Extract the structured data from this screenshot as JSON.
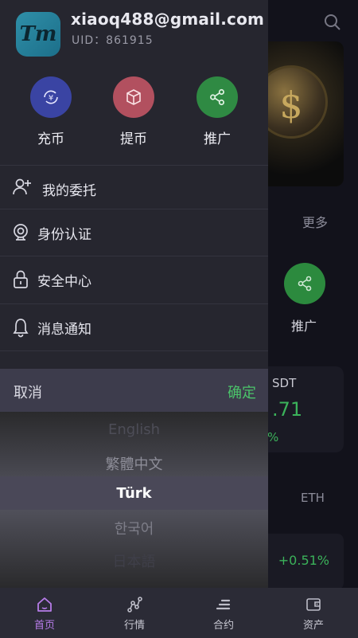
{
  "user": {
    "avatar_text": "Tm",
    "email": "xiaoq488@gmail.com",
    "uid": "UID：861915"
  },
  "quick_actions": [
    {
      "label": "充币",
      "icon": "deposit-yen-icon"
    },
    {
      "label": "提币",
      "icon": "withdraw-box-icon"
    },
    {
      "label": "推广",
      "icon": "share-icon"
    }
  ],
  "menu": [
    {
      "label": "我的委托",
      "icon": "user-add-icon"
    },
    {
      "label": "身份认证",
      "icon": "camera-icon"
    },
    {
      "label": "安全中心",
      "icon": "lock-icon"
    },
    {
      "label": "消息通知",
      "icon": "bell-icon"
    }
  ],
  "picker": {
    "cancel": "取消",
    "confirm": "确定",
    "options": [
      "English",
      "繁體中文",
      "Türk",
      "한국어",
      "日本語"
    ],
    "selected": "Türk"
  },
  "background": {
    "more": "更多",
    "promo_label": "推广",
    "card_symbol": "SDT",
    "card_value": ".71",
    "card_change": "%",
    "tab_eth": "ETH",
    "row_change": "+0.51%"
  },
  "bottom_nav": [
    {
      "label": "首页",
      "icon": "home-icon",
      "active": true
    },
    {
      "label": "行情",
      "icon": "chart-icon",
      "active": false
    },
    {
      "label": "合约",
      "icon": "contract-icon",
      "active": false
    },
    {
      "label": "资产",
      "icon": "wallet-icon",
      "active": false
    }
  ],
  "colors": {
    "accent_green": "#4bc46a",
    "active_purple": "#b77ce9",
    "drawer_bg": "#26262f"
  }
}
